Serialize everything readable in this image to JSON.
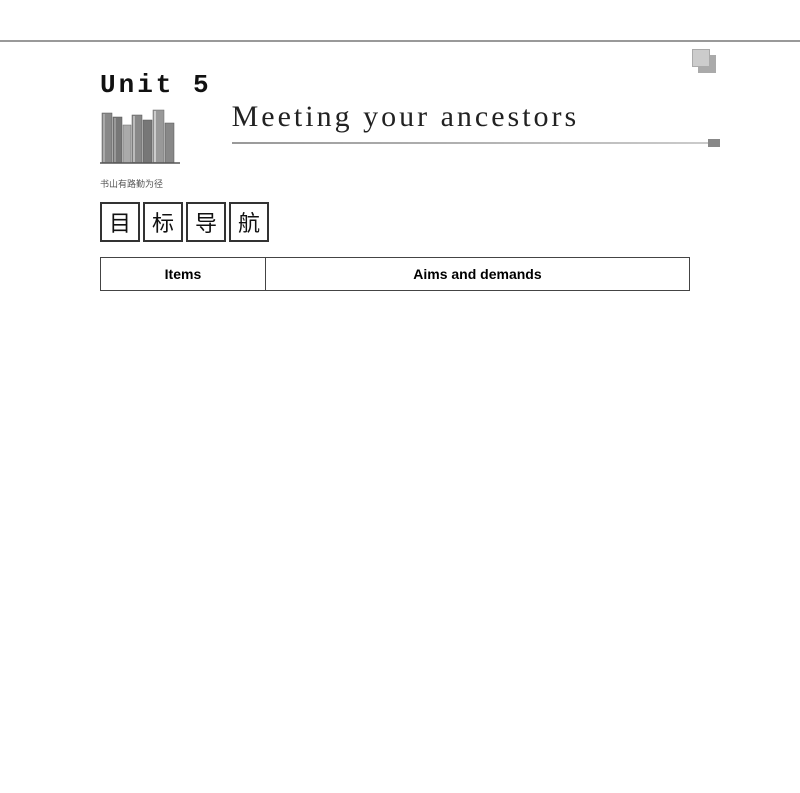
{
  "page": {
    "unit_label": "Unit  5",
    "main_title": "Meeting  your  ancestors",
    "book_caption": "书山有路勤为径",
    "corner_icon_label": "corner-squares",
    "nav_chars": [
      "目",
      "标",
      "导",
      "航"
    ],
    "table": {
      "col1_header": "Items",
      "col2_header": "Aims and demands"
    }
  }
}
